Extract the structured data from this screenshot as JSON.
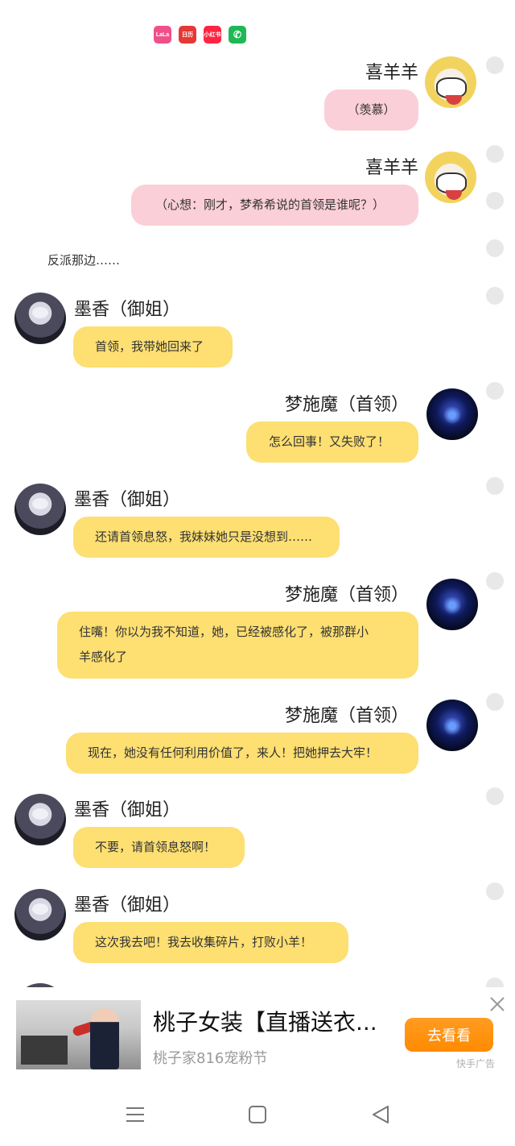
{
  "status_bar": {
    "apps": [
      {
        "name": "lala",
        "label": "LaLa"
      },
      {
        "name": "record",
        "label": "日历"
      },
      {
        "name": "xiaohongshu",
        "label": "小红书"
      },
      {
        "name": "phone",
        "label": "✆"
      }
    ]
  },
  "messages": [
    {
      "sender": "喜羊羊",
      "side": "right",
      "avatar": "sheep-avatar",
      "color": "#fbcfd7",
      "lines": [
        "（羡慕）"
      ]
    },
    {
      "sender": "喜羊羊",
      "side": "right",
      "avatar": "sheep-avatar",
      "color": "#fbcfd7",
      "lines": [
        "（心想：刚才，梦希希说的首领是谁呢？）"
      ]
    },
    {
      "sender": "墨香（御姐）",
      "side": "left",
      "avatar": "moxiang-avatar",
      "color": "#fddf72",
      "lines": [
        "首领，我带她回来了"
      ]
    },
    {
      "sender": "梦施魔（首领）",
      "side": "right",
      "avatar": "leader-avatar",
      "color": "#fddf72",
      "lines": [
        "怎么回事！又失败了！"
      ]
    },
    {
      "sender": "墨香（御姐）",
      "side": "left",
      "avatar": "moxiang-avatar",
      "color": "#fddf72",
      "lines": [
        "还请首领息怒，我妹妹她只是没想到……"
      ]
    },
    {
      "sender": "梦施魔（首领）",
      "side": "right",
      "avatar": "leader-avatar",
      "color": "#fddf72",
      "lines": [
        "住嘴！你以为我不知道，她，已经被感化了，被那群小",
        "羊感化了"
      ]
    },
    {
      "sender": "梦施魔（首领）",
      "side": "right",
      "avatar": "leader-avatar",
      "color": "#fddf72",
      "lines": [
        "现在，她没有任何利用价值了，来人！把她押去大牢！"
      ]
    },
    {
      "sender": "墨香（御姐）",
      "side": "left",
      "avatar": "moxiang-avatar",
      "color": "#fddf72",
      "lines": [
        "不要，请首领息怒啊！"
      ]
    },
    {
      "sender": "墨香（御姐）",
      "side": "left",
      "avatar": "moxiang-avatar",
      "color": "#fddf72",
      "lines": [
        "这次我去吧！我去收集碎片，打败小羊！"
      ]
    }
  ],
  "narration": "反派那边……",
  "ad": {
    "title": "桃子女装【直播送衣...",
    "subtitle": "桃子家816宠粉节",
    "button": "去看看",
    "tag": "快手广告"
  },
  "nav": {
    "menu_icon": "menu-icon",
    "home_icon": "home-square-icon",
    "back_icon": "back-triangle-icon"
  }
}
